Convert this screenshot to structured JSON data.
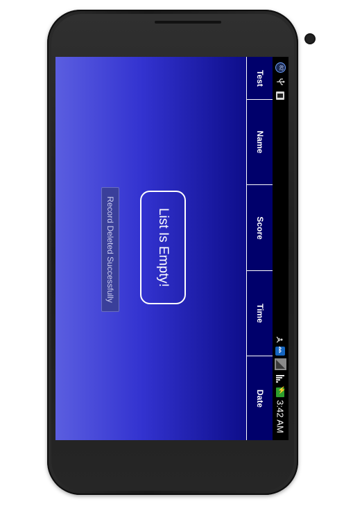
{
  "status_bar": {
    "time": "3:42 AM",
    "notification_badge": "82",
    "icons": [
      "usb-icon",
      "screenshot-icon",
      "wifi-icon",
      "bluetooth-icon",
      "no-signal-icon",
      "signal-icon",
      "battery-charging-icon"
    ]
  },
  "table_header": {
    "columns": [
      "Test",
      "Name",
      "Score",
      "Time",
      "Date"
    ]
  },
  "main": {
    "empty_message": "List Is Empty!"
  },
  "toast": {
    "message": "Record Deleted Successfully"
  },
  "colors": {
    "background_start": "#5b5ee0",
    "background_end": "#0d0d8a",
    "header_background": "#00006b",
    "border": "#ffffff"
  }
}
